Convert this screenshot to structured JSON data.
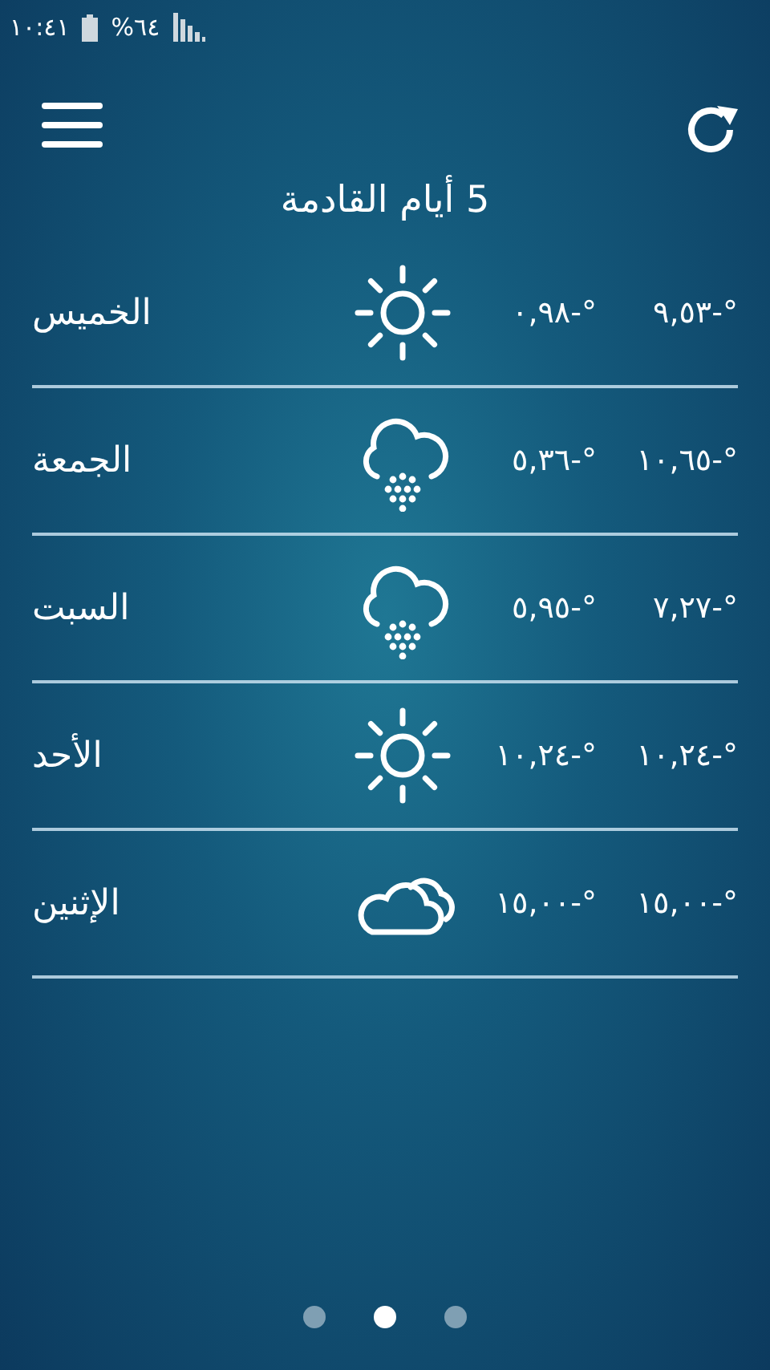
{
  "status_bar": {
    "time": "١٠:٤١",
    "battery": "%٦٤"
  },
  "title": "5 أيام القادمة",
  "days": [
    {
      "day": "الخميس",
      "kind": "sun",
      "low": "٠,٩٨-°",
      "high": "٩,٥٣-°"
    },
    {
      "day": "الجمعة",
      "kind": "snow",
      "low": "٥,٣٦-°",
      "high": "١٠,٦٥-°"
    },
    {
      "day": "السبت",
      "kind": "snow",
      "low": "٥,٩٥-°",
      "high": "٧,٢٧-°"
    },
    {
      "day": "الأحد",
      "kind": "sun",
      "low": "١٠,٢٤-°",
      "high": "١٠,٢٤-°"
    },
    {
      "day": "الإثنين",
      "kind": "cloud",
      "low": "١٥,٠٠-°",
      "high": "١٥,٠٠-°"
    }
  ],
  "pages": [
    {
      "selected": false
    },
    {
      "selected": true
    },
    {
      "selected": false
    }
  ]
}
